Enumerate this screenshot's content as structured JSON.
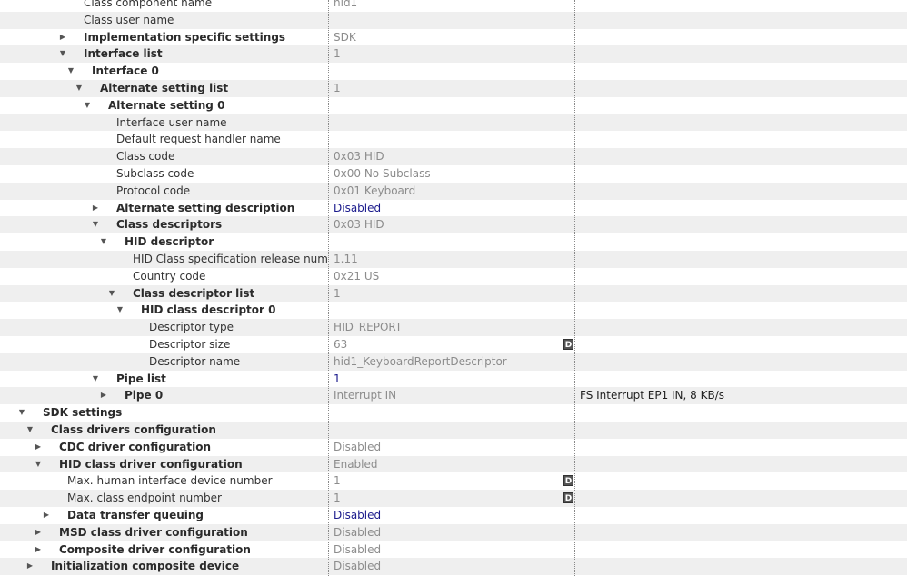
{
  "badge_label": "D",
  "rows": [
    {
      "label": "Class component name",
      "value": "hid1",
      "indent": 0,
      "bold": false,
      "expander": "none"
    },
    {
      "label": "Class user name",
      "value": "",
      "indent": 0,
      "bold": false,
      "expander": "none"
    },
    {
      "label": "Implementation specific settings",
      "value": "SDK",
      "indent": 0,
      "bold": true,
      "expander": "collapsed"
    },
    {
      "label": "Interface list",
      "value": "1",
      "indent": 0,
      "bold": true,
      "expander": "expanded"
    },
    {
      "label": "Interface 0",
      "value": "",
      "indent": 1,
      "bold": true,
      "expander": "expanded"
    },
    {
      "label": "Alternate setting list",
      "value": "1",
      "indent": 2,
      "bold": true,
      "expander": "expanded"
    },
    {
      "label": "Alternate setting 0",
      "value": "",
      "indent": 3,
      "bold": true,
      "expander": "expanded"
    },
    {
      "label": "Interface user name",
      "value": "",
      "indent": 4,
      "bold": false,
      "expander": "none"
    },
    {
      "label": "Default request handler name",
      "value": "",
      "indent": 4,
      "bold": false,
      "expander": "none"
    },
    {
      "label": "Class code",
      "value": "0x03 HID",
      "indent": 4,
      "bold": false,
      "expander": "none"
    },
    {
      "label": "Subclass code",
      "value": "0x00 No Subclass",
      "indent": 4,
      "bold": false,
      "expander": "none"
    },
    {
      "label": "Protocol code",
      "value": "0x01 Keyboard",
      "indent": 4,
      "bold": false,
      "expander": "none"
    },
    {
      "label": "Alternate setting description",
      "value": "Disabled",
      "indent": 4,
      "bold": true,
      "expander": "collapsed",
      "value_link": true
    },
    {
      "label": "Class descriptors",
      "value": "0x03 HID",
      "indent": 4,
      "bold": true,
      "expander": "expanded"
    },
    {
      "label": "HID descriptor",
      "value": "",
      "indent": 5,
      "bold": true,
      "expander": "expanded"
    },
    {
      "label": "HID Class specification release number",
      "value": "1.11",
      "indent": 6,
      "bold": false,
      "expander": "none"
    },
    {
      "label": "Country code",
      "value": "0x21 US",
      "indent": 6,
      "bold": false,
      "expander": "none"
    },
    {
      "label": "Class descriptor list",
      "value": "1",
      "indent": 6,
      "bold": true,
      "expander": "expanded"
    },
    {
      "label": "HID class descriptor 0",
      "value": "",
      "indent": 7,
      "bold": true,
      "expander": "expanded"
    },
    {
      "label": "Descriptor type",
      "value": "HID_REPORT",
      "indent": 8,
      "bold": false,
      "expander": "none"
    },
    {
      "label": "Descriptor size",
      "value": "63",
      "indent": 8,
      "bold": false,
      "expander": "none",
      "badge": true
    },
    {
      "label": "Descriptor name",
      "value": "hid1_KeyboardReportDescriptor",
      "indent": 8,
      "bold": false,
      "expander": "none"
    },
    {
      "label": "Pipe list",
      "value": "1",
      "indent": 4,
      "bold": true,
      "expander": "expanded",
      "value_link": true
    },
    {
      "label": "Pipe 0",
      "value": "Interrupt IN",
      "indent": 5,
      "bold": true,
      "expander": "collapsed",
      "info": "FS Interrupt EP1 IN, 8 KB/s"
    },
    {
      "label": "SDK settings",
      "value": "",
      "indent": -5,
      "bold": true,
      "expander": "expanded"
    },
    {
      "label": "Class drivers configuration",
      "value": "",
      "indent": -4,
      "bold": true,
      "expander": "expanded"
    },
    {
      "label": "CDC driver configuration",
      "value": "Disabled",
      "indent": -3,
      "bold": true,
      "expander": "collapsed"
    },
    {
      "label": "HID class driver configuration",
      "value": "Enabled",
      "indent": -3,
      "bold": true,
      "expander": "expanded"
    },
    {
      "label": "Max. human interface device number",
      "value": "1",
      "indent": -2,
      "bold": false,
      "expander": "none",
      "badge": true
    },
    {
      "label": "Max. class endpoint number",
      "value": "1",
      "indent": -2,
      "bold": false,
      "expander": "none",
      "badge": true
    },
    {
      "label": "Data transfer queuing",
      "value": "Disabled",
      "indent": -2,
      "bold": true,
      "expander": "collapsed",
      "value_link": true
    },
    {
      "label": "MSD class driver configuration",
      "value": "Disabled",
      "indent": -3,
      "bold": true,
      "expander": "collapsed"
    },
    {
      "label": "Composite driver configuration",
      "value": "Disabled",
      "indent": -3,
      "bold": true,
      "expander": "collapsed"
    },
    {
      "label": "Initialization composite device",
      "value": "Disabled",
      "indent": -4,
      "bold": true,
      "expander": "collapsed"
    }
  ]
}
